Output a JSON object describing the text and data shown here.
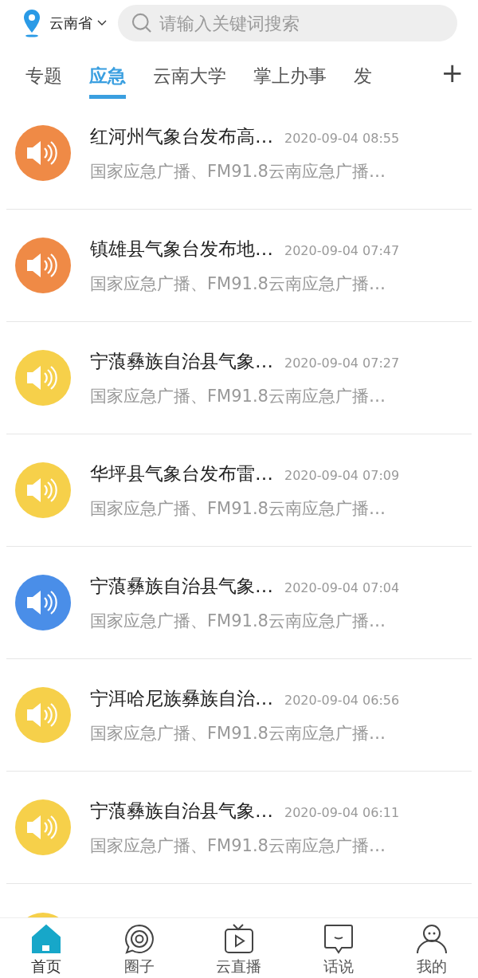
{
  "header": {
    "location": "云南省",
    "search": {
      "placeholder": "请输入关键词搜索"
    }
  },
  "tabs": [
    {
      "label": "专题",
      "selected": false
    },
    {
      "label": "应急",
      "selected": true
    },
    {
      "label": "云南大学",
      "selected": false
    },
    {
      "label": "掌上办事",
      "selected": false
    },
    {
      "label": "发",
      "selected": false
    }
  ],
  "add_tab": "+",
  "items": [
    {
      "title": "红河州气象台发布高…",
      "time": "2020-09-04 08:55",
      "source": "国家应急广播、FM91.8云南应急广播…",
      "color": "#ef8a46"
    },
    {
      "title": "镇雄县气象台发布地…",
      "time": "2020-09-04 07:47",
      "source": "国家应急广播、FM91.8云南应急广播…",
      "color": "#ef8a46"
    },
    {
      "title": "宁蒗彝族自治县气象…",
      "time": "2020-09-04 07:27",
      "source": "国家应急广播、FM91.8云南应急广播…",
      "color": "#f6d04a"
    },
    {
      "title": "华坪县气象台发布雷…",
      "time": "2020-09-04 07:09",
      "source": "国家应急广播、FM91.8云南应急广播…",
      "color": "#f6d04a"
    },
    {
      "title": "宁蒗彝族自治县气象…",
      "time": "2020-09-04 07:04",
      "source": "国家应急广播、FM91.8云南应急广播…",
      "color": "#4a8ee8"
    },
    {
      "title": "宁洱哈尼族彝族自治…",
      "time": "2020-09-04 06:56",
      "source": "国家应急广播、FM91.8云南应急广播…",
      "color": "#f6d04a"
    },
    {
      "title": "宁蒗彝族自治县气象…",
      "time": "2020-09-04 06:11",
      "source": "国家应急广播、FM91.8云南应急广播…",
      "color": "#f6d04a"
    },
    {
      "color": "#f6d04a"
    }
  ],
  "nav": [
    {
      "label": "首页",
      "selected": true
    },
    {
      "label": "圈子",
      "selected": false
    },
    {
      "label": "云直播",
      "selected": false
    },
    {
      "label": "话说",
      "selected": false
    },
    {
      "label": "我的",
      "selected": false
    }
  ]
}
